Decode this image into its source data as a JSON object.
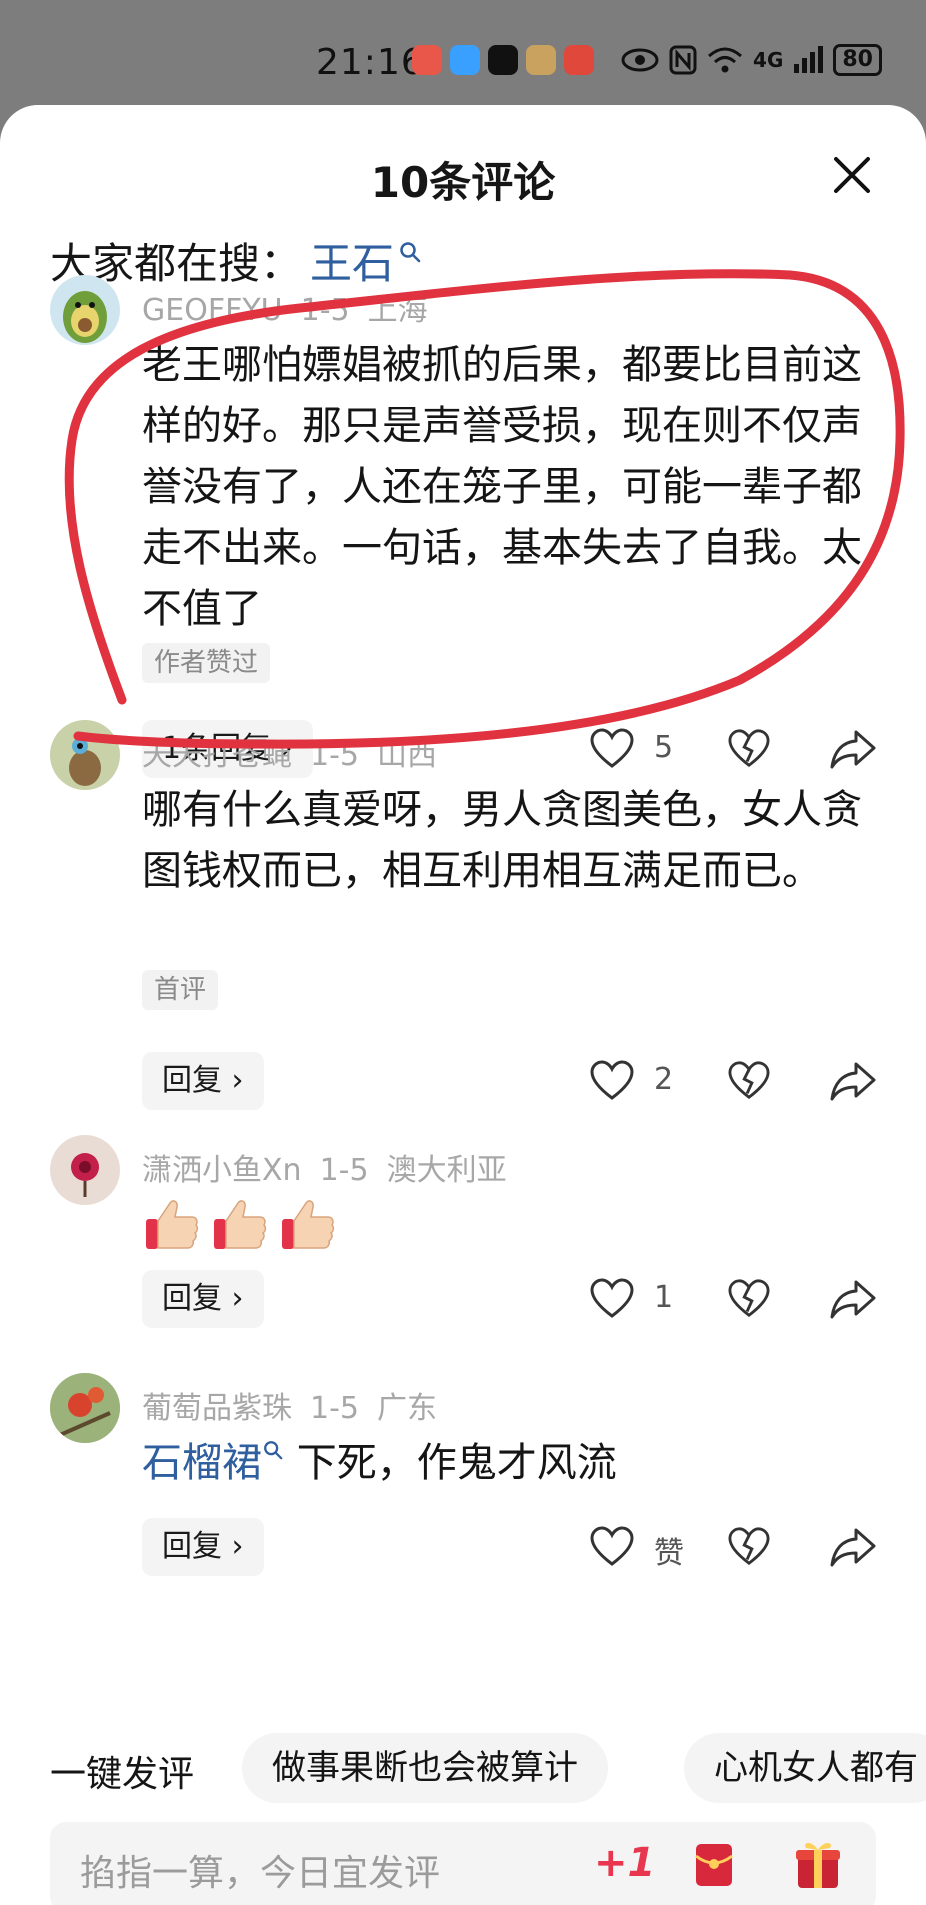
{
  "status_bar": {
    "time": "21:16",
    "signal_label": "4G",
    "battery": "80",
    "icons": [
      "call-icon",
      "chat-icon",
      "tiktok-icon",
      "game-icon",
      "app-icon",
      "eye-icon",
      "nfc-icon",
      "wifi-icon",
      "signal-icon",
      "battery-icon"
    ]
  },
  "sheet": {
    "title": "10条评论",
    "close_icon": "close-icon",
    "search_prefix": "大家都在搜：",
    "search_term": "王石"
  },
  "comments": [
    {
      "username": "GEOFFYU",
      "date": "1-5",
      "location": "上海",
      "text": "老王哪怕嫖娼被抓的后果，都要比目前这样的好。那只是声誉受损，现在则不仅声誉没有了，人还在笼子里，可能一辈子都走不出来。一句话，基本失去了自我。太不值了",
      "tag": "作者赞过",
      "reply_label": "1条回复 ›",
      "likes": "5"
    },
    {
      "username": "天天打苍蝇",
      "date": "1-5",
      "location": "山西",
      "text": "哪有什么真爱呀，男人贪图美色，女人贪图钱权而已，相互利用相互满足而已。",
      "tag": "首评",
      "reply_label": "回复 ›",
      "likes": "2"
    },
    {
      "username": "潇洒小鱼Xn",
      "date": "1-5",
      "location": "澳大利亚",
      "text": "",
      "emoji": [
        "thumbs-up-emoji",
        "thumbs-up-emoji",
        "thumbs-up-emoji"
      ],
      "reply_label": "回复 ›",
      "likes": "1"
    },
    {
      "username": "葡萄品紫珠",
      "date": "1-5",
      "location": "广东",
      "link_text": "石榴裙",
      "text": " 下死，作鬼才风流",
      "reply_label": "回复 ›",
      "likes": "赞"
    }
  ],
  "quick_comments": {
    "label": "一键发评",
    "chips": [
      "做事果断也会被算计",
      "心机女人都有"
    ]
  },
  "input": {
    "placeholder": "掐指一算，今日宜发评",
    "plus_one": "+1"
  },
  "colors": {
    "link": "#2f5f9e",
    "annotation": "#e0333f",
    "plus_one": "#e8364f"
  }
}
